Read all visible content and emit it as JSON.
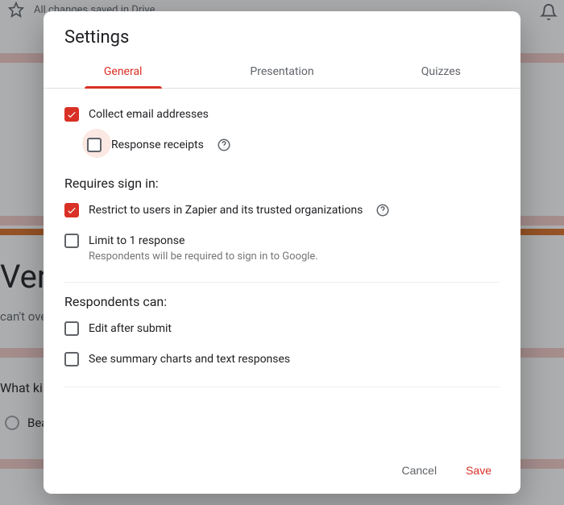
{
  "bg": {
    "saved_text": "All changes saved in Drive",
    "big_text": "Very",
    "cant_over": "can't ove",
    "question": "What kin",
    "radio_option": "Beat"
  },
  "modal": {
    "title": "Settings",
    "tabs": {
      "general": "General",
      "presentation": "Presentation",
      "quizzes": "Quizzes"
    },
    "collect_email": "Collect email addresses",
    "response_receipts": "Response receipts",
    "requires_signin": "Requires sign in:",
    "restrict": "Restrict to users in Zapier and its trusted organizations",
    "limit": "Limit to 1 response",
    "limit_sub": "Respondents will be required to sign in to Google.",
    "respondents_can": "Respondents can:",
    "edit_after": "Edit after submit",
    "see_summary": "See summary charts and text responses",
    "cancel": "Cancel",
    "save": "Save"
  }
}
